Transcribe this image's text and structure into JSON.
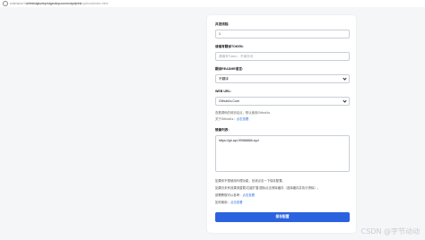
{
  "browser": {
    "url_scheme": "extension://",
    "url_host": "ahfmbdgbcekphdgeoknpoonmndpejmhk",
    "url_path": "/options/index.html"
  },
  "form": {
    "threads_label": "并发线程:",
    "threads_value": "1",
    "token_label": "请填写翻译TOKEN:",
    "token_placeholder": "请填写Token，不填亦可",
    "translate_label": "翻译README语言:",
    "translate_value": "不翻译",
    "web_url_label": "WEB URL:",
    "web_url_value": "Github1s.Com",
    "web_url_hint": "查看源码的网页站点，默认使用Github1s",
    "web_url_hint2_prefix": "关于Github1s：",
    "web_url_hint2_link": "点击查看",
    "list_label": "镜像列表:",
    "list_value": "https://gh.api.99988866.xyz/"
  },
  "notes": {
    "line1": "如果你不想使用代理功能，也请点击一下保存配置。",
    "line2": "如果仍未有效果请重载/右键扩展 图标点击清除缓存（选择缓存并执行清除）。",
    "line3_prefix": "部署教程可以参考：",
    "line3_link": "点击查看",
    "line4_prefix": "如何使用：",
    "line4_link": "点击查看"
  },
  "actions": {
    "save_label": "保存配置"
  },
  "watermark": "CSDN @字节动动",
  "colors": {
    "accent": "#2b62e0",
    "link": "#2b6fe6"
  }
}
